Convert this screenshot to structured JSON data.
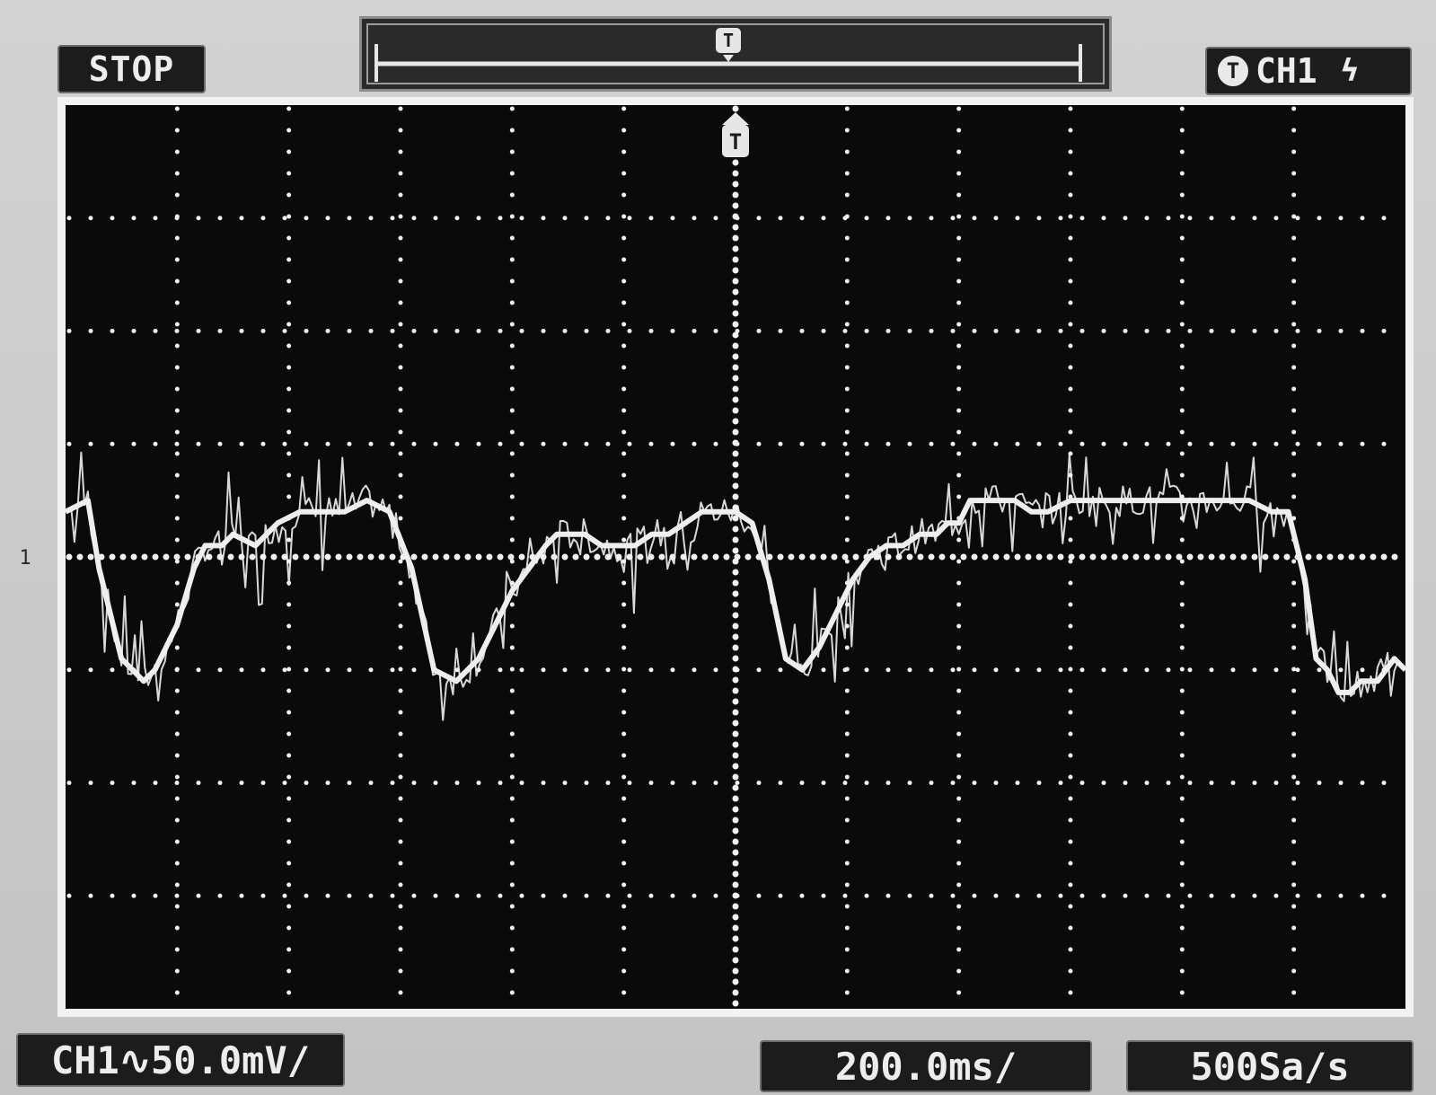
{
  "status": {
    "state": "STOP"
  },
  "trigger": {
    "marker": "T",
    "source": "CH1",
    "edge": "ϟ"
  },
  "channel": {
    "marker": "1",
    "scale_label": "CH1∿50.0mV/"
  },
  "timebase": {
    "label": "200.0ms/"
  },
  "sample_rate": {
    "label": "500Sa/s"
  },
  "colors": {
    "trace": "#eeeeee",
    "grid": "#f2f2f2",
    "screen_background": "#0a0a0a",
    "bezel": "#c9c9c9"
  },
  "chart_data": {
    "type": "line",
    "xlim": [
      -1200,
      1200
    ],
    "ylim": [
      -200,
      200
    ],
    "grid": true,
    "x_unit": "ms",
    "y_unit": "mV",
    "trigger_x": 0,
    "series": [
      {
        "x": [
          -1200,
          -1160,
          -1140,
          -1100,
          -1060,
          -1040,
          -1000,
          -970,
          -950,
          -920,
          -900,
          -860,
          -820,
          -780,
          -740,
          -700,
          -660,
          -620,
          -580,
          -540,
          -500,
          -460,
          -420,
          -400,
          -370,
          -340,
          -320,
          -300,
          -270,
          -240,
          -210,
          -180,
          -150,
          -120,
          -90,
          -60,
          -30,
          0,
          30,
          60,
          90,
          120,
          150,
          180,
          210,
          240,
          270,
          300,
          330,
          360,
          380,
          400,
          420,
          440,
          460,
          480,
          500,
          530,
          560,
          600,
          640,
          680,
          720,
          760,
          800,
          840,
          880,
          920,
          960,
          990,
          1020,
          1040,
          1060,
          1080,
          1100,
          1120,
          1150,
          1180,
          1200
        ],
        "y": [
          20,
          25,
          -5,
          -45,
          -55,
          -50,
          -30,
          -5,
          5,
          5,
          10,
          5,
          15,
          20,
          20,
          20,
          25,
          20,
          -5,
          -50,
          -55,
          -45,
          -25,
          -15,
          -5,
          5,
          10,
          10,
          10,
          5,
          5,
          5,
          10,
          10,
          15,
          20,
          20,
          20,
          15,
          -10,
          -45,
          -50,
          -40,
          -25,
          -10,
          0,
          5,
          5,
          10,
          10,
          15,
          15,
          25,
          25,
          25,
          25,
          25,
          20,
          20,
          25,
          25,
          25,
          25,
          25,
          25,
          25,
          25,
          25,
          20,
          20,
          -10,
          -45,
          -50,
          -60,
          -60,
          -55,
          -55,
          -45,
          -50
        ]
      }
    ]
  }
}
